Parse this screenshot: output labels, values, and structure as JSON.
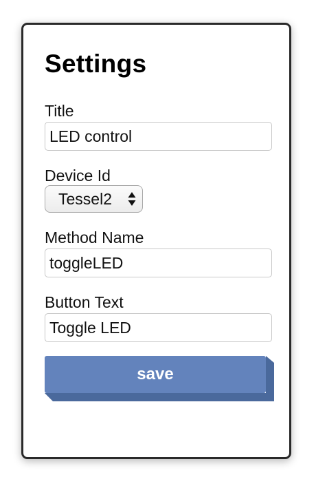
{
  "settings": {
    "title": "Settings",
    "fields": [
      {
        "label": "Title",
        "value": "LED control"
      },
      {
        "label": "Device Id",
        "value": "Tessel2"
      },
      {
        "label": "Method Name",
        "value": "toggleLED"
      },
      {
        "label": "Button Text",
        "value": "Toggle LED"
      }
    ],
    "save_label": "save"
  },
  "colors": {
    "button_face": "#6383bc",
    "button_edge": "#4a699c",
    "panel_border": "#2a2a2a"
  }
}
